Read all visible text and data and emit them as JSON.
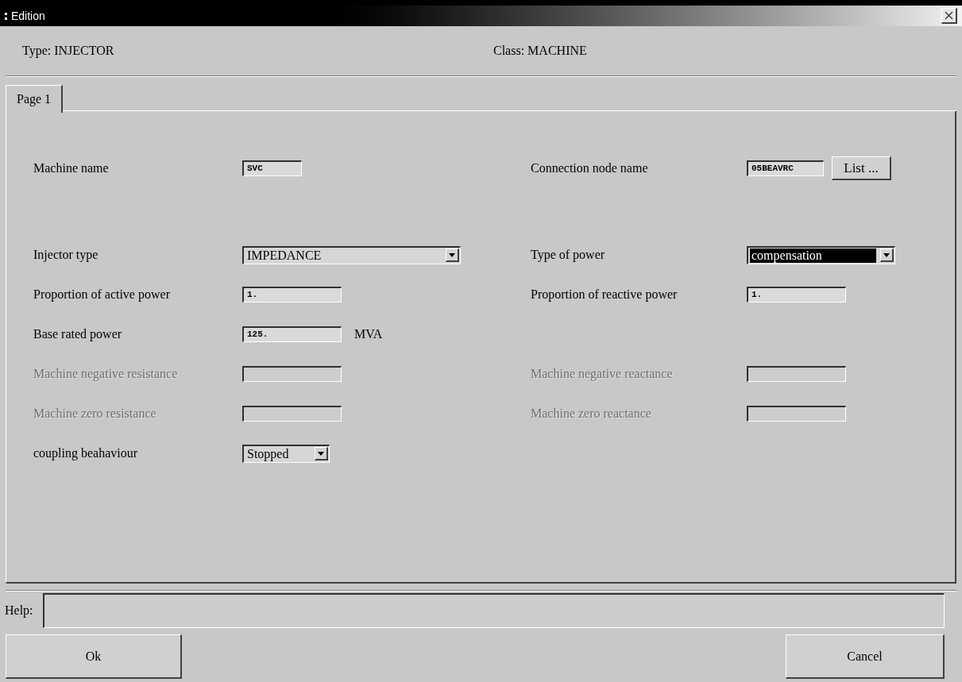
{
  "window": {
    "title": "Edition"
  },
  "header": {
    "type": "Type: INJECTOR",
    "class": "Class: MACHINE"
  },
  "tabs": [
    {
      "label": "Page 1",
      "selected": true
    }
  ],
  "rows": [
    {
      "left": {
        "kind": "text",
        "label": "Machine name",
        "value": "SVC",
        "disabled": false
      },
      "right": {
        "kind": "text",
        "label": "Connection node name",
        "value": "05BEAVRC",
        "disabled": false,
        "button": "List ..."
      }
    },
    {
      "left": {
        "kind": "combo",
        "label": "Injector type",
        "value": "IMPEDANCE",
        "disabled": false,
        "highlighted": false
      },
      "right": {
        "kind": "combo",
        "label": "Type of power",
        "value": "compensation",
        "disabled": false,
        "highlighted": true
      }
    },
    {
      "left": {
        "kind": "text",
        "label": "Proportion of active power",
        "value": "1.",
        "disabled": false
      },
      "right": {
        "kind": "text",
        "label": "Proportion of reactive power",
        "value": "1.",
        "disabled": false
      }
    },
    {
      "left": {
        "kind": "text",
        "label": "Base rated power",
        "value": "125.",
        "disabled": false,
        "unit": "MVA"
      }
    },
    {
      "left": {
        "kind": "text",
        "label": "Machine negative resistance",
        "disabled": true
      },
      "right": {
        "kind": "text",
        "label": "Machine negative reactance",
        "disabled": true
      }
    },
    {
      "left": {
        "kind": "text",
        "label": "Machine zero resistance",
        "disabled": true
      },
      "right": {
        "kind": "text",
        "label": "Machine zero reactance",
        "disabled": true
      }
    },
    {
      "left": {
        "kind": "combo",
        "label": "coupling beahaviour",
        "value": "Stopped",
        "disabled": false,
        "highlighted": false
      }
    }
  ],
  "help": {
    "label": "Help:"
  },
  "buttons": [
    {
      "label": "Ok"
    },
    {
      "label": "Cancel"
    }
  ]
}
